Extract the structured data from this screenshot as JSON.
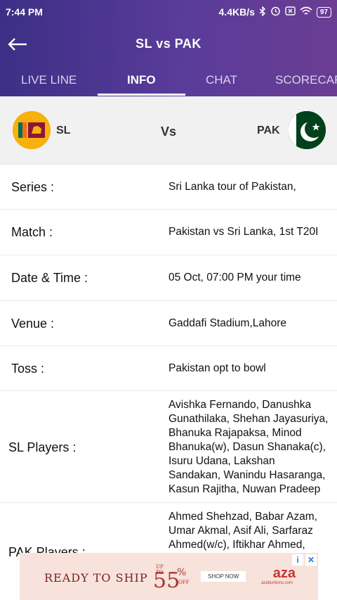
{
  "status": {
    "time": "7:44 PM",
    "speed": "4.4KB/s",
    "battery": "97"
  },
  "titlebar": {
    "title": "SL  vs  PAK"
  },
  "tabs": [
    {
      "label": "LIVE LINE"
    },
    {
      "label": "INFO"
    },
    {
      "label": "CHAT"
    },
    {
      "label": "SCORECARD"
    }
  ],
  "teams": {
    "home": "SL",
    "vs": "Vs",
    "away": "PAK"
  },
  "info": [
    {
      "label": "Series :",
      "value": "Sri Lanka tour of Pakistan,"
    },
    {
      "label": "Match :",
      "value": "Pakistan vs Sri Lanka, 1st T20I"
    },
    {
      "label": "Date & Time :",
      "value": "05 Oct, 07:00 PM your time"
    },
    {
      "label": "Venue :",
      "value": "Gaddafi Stadium,Lahore"
    },
    {
      "label": "Toss :",
      "value": "Pakistan opt to bowl"
    },
    {
      "label": "SL Players :",
      "value": "Avishka Fernando, Danushka Gunathilaka, Shehan Jayasuriya, Bhanuka Rajapaksa, Minod Bhanuka(w), Dasun Shanaka(c), Isuru Udana, Lakshan Sandakan, Wanindu Hasaranga, Kasun Rajitha, Nuwan Pradeep"
    },
    {
      "label": "PAK Players :",
      "value": "Ahmed Shehzad, Babar Azam, Umar Akmal, Asif Ali, Sarfaraz Ahmed(w/c), Iftikhar Ahmed,"
    }
  ],
  "ad": {
    "headline": "READY TO SHIP",
    "upto": "UP TO",
    "percent": "55",
    "percent_sign": "%",
    "off": "OFF",
    "shop": "SHOP NOW",
    "brand": "aza",
    "site": "azafashions.com"
  }
}
